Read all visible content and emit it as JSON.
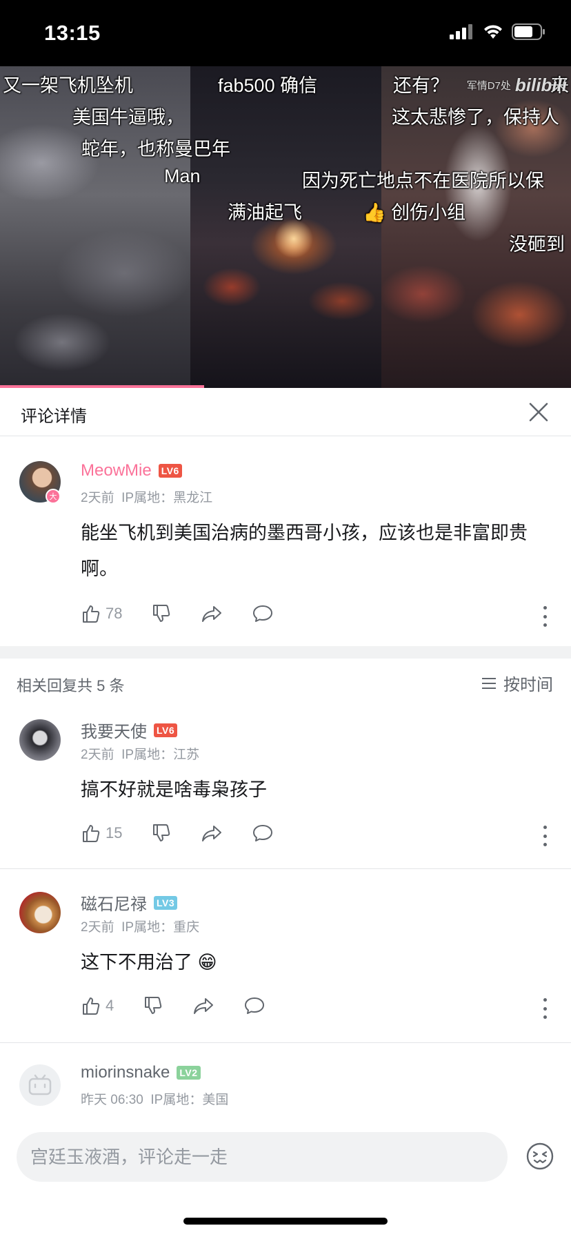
{
  "status_bar": {
    "time": "13:15"
  },
  "video": {
    "watermark_text": "军情D7处",
    "watermark_logo": "bilibili",
    "progress": 0.357,
    "danmaku": [
      "又一架飞机坠机",
      "fab500 确信",
      "还有？",
      "来",
      "美国牛逼哦，",
      "这太悲惨了，保持人",
      "蛇年，也称曼巴年",
      "Man",
      "因为死亡地点不在医院所以保",
      "满油起飞",
      "👍 创伤小组",
      "没砸到"
    ]
  },
  "header": {
    "title": "评论详情",
    "close_icon": "close-icon"
  },
  "main_comment": {
    "username": "MeowMie",
    "level": "LV6",
    "avatar_badge": "大",
    "time": "2天前",
    "ip": "IP属地：黑龙江",
    "text": "能坐飞机到美国治病的墨西哥小孩，应该也是非富即贵啊。",
    "likes": "78"
  },
  "replies_header": {
    "count_text": "相关回复共 5 条",
    "sort_label": "按时间"
  },
  "replies": [
    {
      "username": "我要天使",
      "level": "LV6",
      "time": "2天前",
      "ip": "IP属地：江苏",
      "text": "搞不好就是啥毒枭孩子",
      "likes": "15"
    },
    {
      "username": "磁石尼禄",
      "level": "LV3",
      "time": "2天前",
      "ip": "IP属地：重庆",
      "text": "这下不用治了",
      "emoji": "😁",
      "likes": "4"
    },
    {
      "username": "miorinsnake",
      "level": "LV2",
      "time": "昨天 06:30",
      "ip": "IP属地：美国"
    }
  ],
  "input": {
    "placeholder": "宫廷玉液酒，评论走一走"
  },
  "colors": {
    "brand_pink": "#fb7299",
    "lv6": "#ee5544",
    "lv3": "#73c9e5",
    "lv2": "#8bd29b"
  }
}
